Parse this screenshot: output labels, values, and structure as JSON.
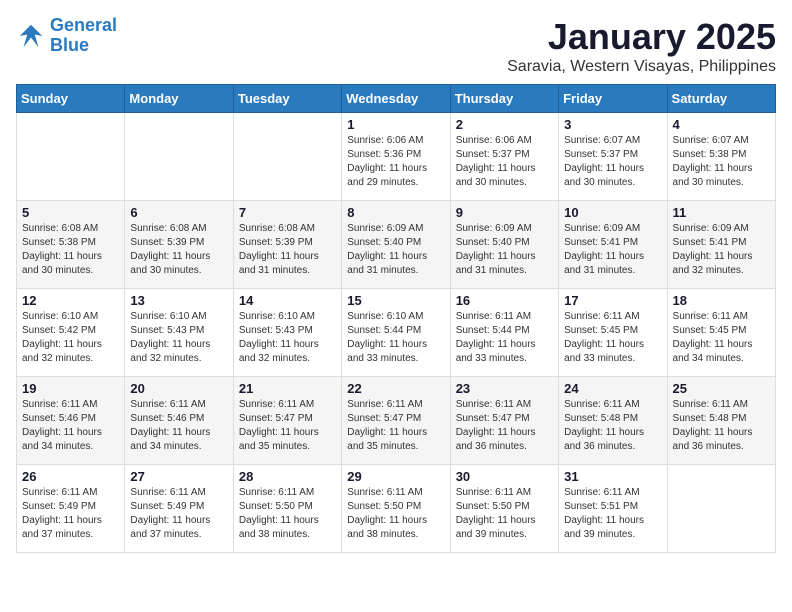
{
  "header": {
    "logo_line1": "General",
    "logo_line2": "Blue",
    "month": "January 2025",
    "location": "Saravia, Western Visayas, Philippines"
  },
  "weekdays": [
    "Sunday",
    "Monday",
    "Tuesday",
    "Wednesday",
    "Thursday",
    "Friday",
    "Saturday"
  ],
  "weeks": [
    [
      {
        "day": "",
        "info": ""
      },
      {
        "day": "",
        "info": ""
      },
      {
        "day": "",
        "info": ""
      },
      {
        "day": "1",
        "info": "Sunrise: 6:06 AM\nSunset: 5:36 PM\nDaylight: 11 hours\nand 29 minutes."
      },
      {
        "day": "2",
        "info": "Sunrise: 6:06 AM\nSunset: 5:37 PM\nDaylight: 11 hours\nand 30 minutes."
      },
      {
        "day": "3",
        "info": "Sunrise: 6:07 AM\nSunset: 5:37 PM\nDaylight: 11 hours\nand 30 minutes."
      },
      {
        "day": "4",
        "info": "Sunrise: 6:07 AM\nSunset: 5:38 PM\nDaylight: 11 hours\nand 30 minutes."
      }
    ],
    [
      {
        "day": "5",
        "info": "Sunrise: 6:08 AM\nSunset: 5:38 PM\nDaylight: 11 hours\nand 30 minutes."
      },
      {
        "day": "6",
        "info": "Sunrise: 6:08 AM\nSunset: 5:39 PM\nDaylight: 11 hours\nand 30 minutes."
      },
      {
        "day": "7",
        "info": "Sunrise: 6:08 AM\nSunset: 5:39 PM\nDaylight: 11 hours\nand 31 minutes."
      },
      {
        "day": "8",
        "info": "Sunrise: 6:09 AM\nSunset: 5:40 PM\nDaylight: 11 hours\nand 31 minutes."
      },
      {
        "day": "9",
        "info": "Sunrise: 6:09 AM\nSunset: 5:40 PM\nDaylight: 11 hours\nand 31 minutes."
      },
      {
        "day": "10",
        "info": "Sunrise: 6:09 AM\nSunset: 5:41 PM\nDaylight: 11 hours\nand 31 minutes."
      },
      {
        "day": "11",
        "info": "Sunrise: 6:09 AM\nSunset: 5:41 PM\nDaylight: 11 hours\nand 32 minutes."
      }
    ],
    [
      {
        "day": "12",
        "info": "Sunrise: 6:10 AM\nSunset: 5:42 PM\nDaylight: 11 hours\nand 32 minutes."
      },
      {
        "day": "13",
        "info": "Sunrise: 6:10 AM\nSunset: 5:43 PM\nDaylight: 11 hours\nand 32 minutes."
      },
      {
        "day": "14",
        "info": "Sunrise: 6:10 AM\nSunset: 5:43 PM\nDaylight: 11 hours\nand 32 minutes."
      },
      {
        "day": "15",
        "info": "Sunrise: 6:10 AM\nSunset: 5:44 PM\nDaylight: 11 hours\nand 33 minutes."
      },
      {
        "day": "16",
        "info": "Sunrise: 6:11 AM\nSunset: 5:44 PM\nDaylight: 11 hours\nand 33 minutes."
      },
      {
        "day": "17",
        "info": "Sunrise: 6:11 AM\nSunset: 5:45 PM\nDaylight: 11 hours\nand 33 minutes."
      },
      {
        "day": "18",
        "info": "Sunrise: 6:11 AM\nSunset: 5:45 PM\nDaylight: 11 hours\nand 34 minutes."
      }
    ],
    [
      {
        "day": "19",
        "info": "Sunrise: 6:11 AM\nSunset: 5:46 PM\nDaylight: 11 hours\nand 34 minutes."
      },
      {
        "day": "20",
        "info": "Sunrise: 6:11 AM\nSunset: 5:46 PM\nDaylight: 11 hours\nand 34 minutes."
      },
      {
        "day": "21",
        "info": "Sunrise: 6:11 AM\nSunset: 5:47 PM\nDaylight: 11 hours\nand 35 minutes."
      },
      {
        "day": "22",
        "info": "Sunrise: 6:11 AM\nSunset: 5:47 PM\nDaylight: 11 hours\nand 35 minutes."
      },
      {
        "day": "23",
        "info": "Sunrise: 6:11 AM\nSunset: 5:47 PM\nDaylight: 11 hours\nand 36 minutes."
      },
      {
        "day": "24",
        "info": "Sunrise: 6:11 AM\nSunset: 5:48 PM\nDaylight: 11 hours\nand 36 minutes."
      },
      {
        "day": "25",
        "info": "Sunrise: 6:11 AM\nSunset: 5:48 PM\nDaylight: 11 hours\nand 36 minutes."
      }
    ],
    [
      {
        "day": "26",
        "info": "Sunrise: 6:11 AM\nSunset: 5:49 PM\nDaylight: 11 hours\nand 37 minutes."
      },
      {
        "day": "27",
        "info": "Sunrise: 6:11 AM\nSunset: 5:49 PM\nDaylight: 11 hours\nand 37 minutes."
      },
      {
        "day": "28",
        "info": "Sunrise: 6:11 AM\nSunset: 5:50 PM\nDaylight: 11 hours\nand 38 minutes."
      },
      {
        "day": "29",
        "info": "Sunrise: 6:11 AM\nSunset: 5:50 PM\nDaylight: 11 hours\nand 38 minutes."
      },
      {
        "day": "30",
        "info": "Sunrise: 6:11 AM\nSunset: 5:50 PM\nDaylight: 11 hours\nand 39 minutes."
      },
      {
        "day": "31",
        "info": "Sunrise: 6:11 AM\nSunset: 5:51 PM\nDaylight: 11 hours\nand 39 minutes."
      },
      {
        "day": "",
        "info": ""
      }
    ]
  ]
}
